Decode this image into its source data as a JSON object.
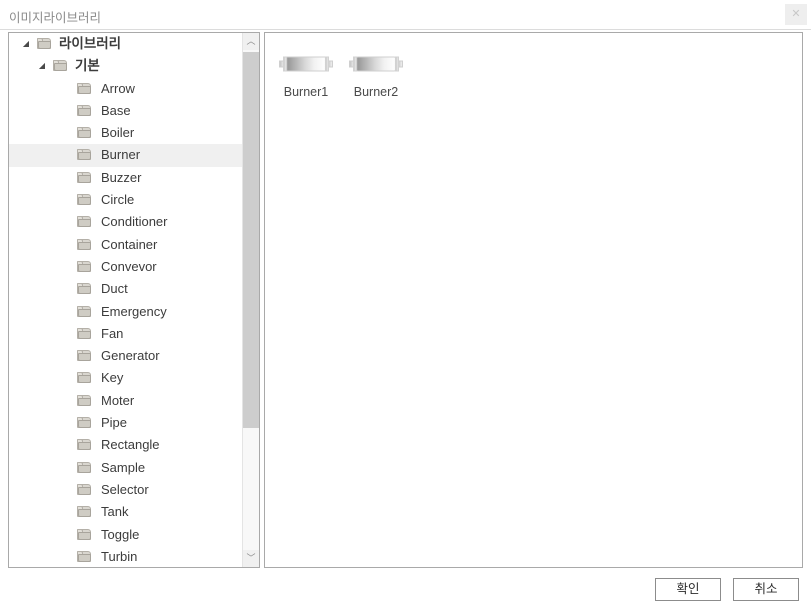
{
  "window": {
    "title": "이미지라이브러리",
    "close_icon": "close-icon",
    "close_glyph": "✕"
  },
  "tree": {
    "expand_glyph": "◢",
    "scrollbar": {
      "up_glyph": "︿",
      "down_glyph": "﹀"
    },
    "nodes": [
      {
        "label": "라이브러리",
        "depth": 0,
        "expanded": true,
        "selected": false,
        "korean": true
      },
      {
        "label": "기본",
        "depth": 1,
        "expanded": true,
        "selected": false,
        "korean": true
      },
      {
        "label": "Arrow",
        "depth": 2,
        "expanded": false,
        "selected": false,
        "korean": false
      },
      {
        "label": "Base",
        "depth": 2,
        "expanded": false,
        "selected": false,
        "korean": false
      },
      {
        "label": "Boiler",
        "depth": 2,
        "expanded": false,
        "selected": false,
        "korean": false
      },
      {
        "label": "Burner",
        "depth": 2,
        "expanded": false,
        "selected": true,
        "korean": false
      },
      {
        "label": "Buzzer",
        "depth": 2,
        "expanded": false,
        "selected": false,
        "korean": false
      },
      {
        "label": "Circle",
        "depth": 2,
        "expanded": false,
        "selected": false,
        "korean": false
      },
      {
        "label": "Conditioner",
        "depth": 2,
        "expanded": false,
        "selected": false,
        "korean": false
      },
      {
        "label": "Container",
        "depth": 2,
        "expanded": false,
        "selected": false,
        "korean": false
      },
      {
        "label": "Convevor",
        "depth": 2,
        "expanded": false,
        "selected": false,
        "korean": false
      },
      {
        "label": "Duct",
        "depth": 2,
        "expanded": false,
        "selected": false,
        "korean": false
      },
      {
        "label": "Emergency",
        "depth": 2,
        "expanded": false,
        "selected": false,
        "korean": false
      },
      {
        "label": "Fan",
        "depth": 2,
        "expanded": false,
        "selected": false,
        "korean": false
      },
      {
        "label": "Generator",
        "depth": 2,
        "expanded": false,
        "selected": false,
        "korean": false
      },
      {
        "label": "Key",
        "depth": 2,
        "expanded": false,
        "selected": false,
        "korean": false
      },
      {
        "label": "Moter",
        "depth": 2,
        "expanded": false,
        "selected": false,
        "korean": false
      },
      {
        "label": "Pipe",
        "depth": 2,
        "expanded": false,
        "selected": false,
        "korean": false
      },
      {
        "label": "Rectangle",
        "depth": 2,
        "expanded": false,
        "selected": false,
        "korean": false
      },
      {
        "label": "Sample",
        "depth": 2,
        "expanded": false,
        "selected": false,
        "korean": false
      },
      {
        "label": "Selector",
        "depth": 2,
        "expanded": false,
        "selected": false,
        "korean": false
      },
      {
        "label": "Tank",
        "depth": 2,
        "expanded": false,
        "selected": false,
        "korean": false
      },
      {
        "label": "Toggle",
        "depth": 2,
        "expanded": false,
        "selected": false,
        "korean": false
      },
      {
        "label": "Turbin",
        "depth": 2,
        "expanded": false,
        "selected": false,
        "korean": false
      }
    ]
  },
  "content": {
    "items": [
      {
        "label": "Burner1",
        "shape": "square"
      },
      {
        "label": "Burner2",
        "shape": "rounded"
      }
    ]
  },
  "footer": {
    "ok_label": "확인",
    "cancel_label": "취소"
  },
  "colors": {
    "selection_bg": "#f0f0f0",
    "panel_border": "#a9a9a9",
    "title_text": "#8a8a8a",
    "scrollbar_thumb": "#cdcdcd"
  }
}
